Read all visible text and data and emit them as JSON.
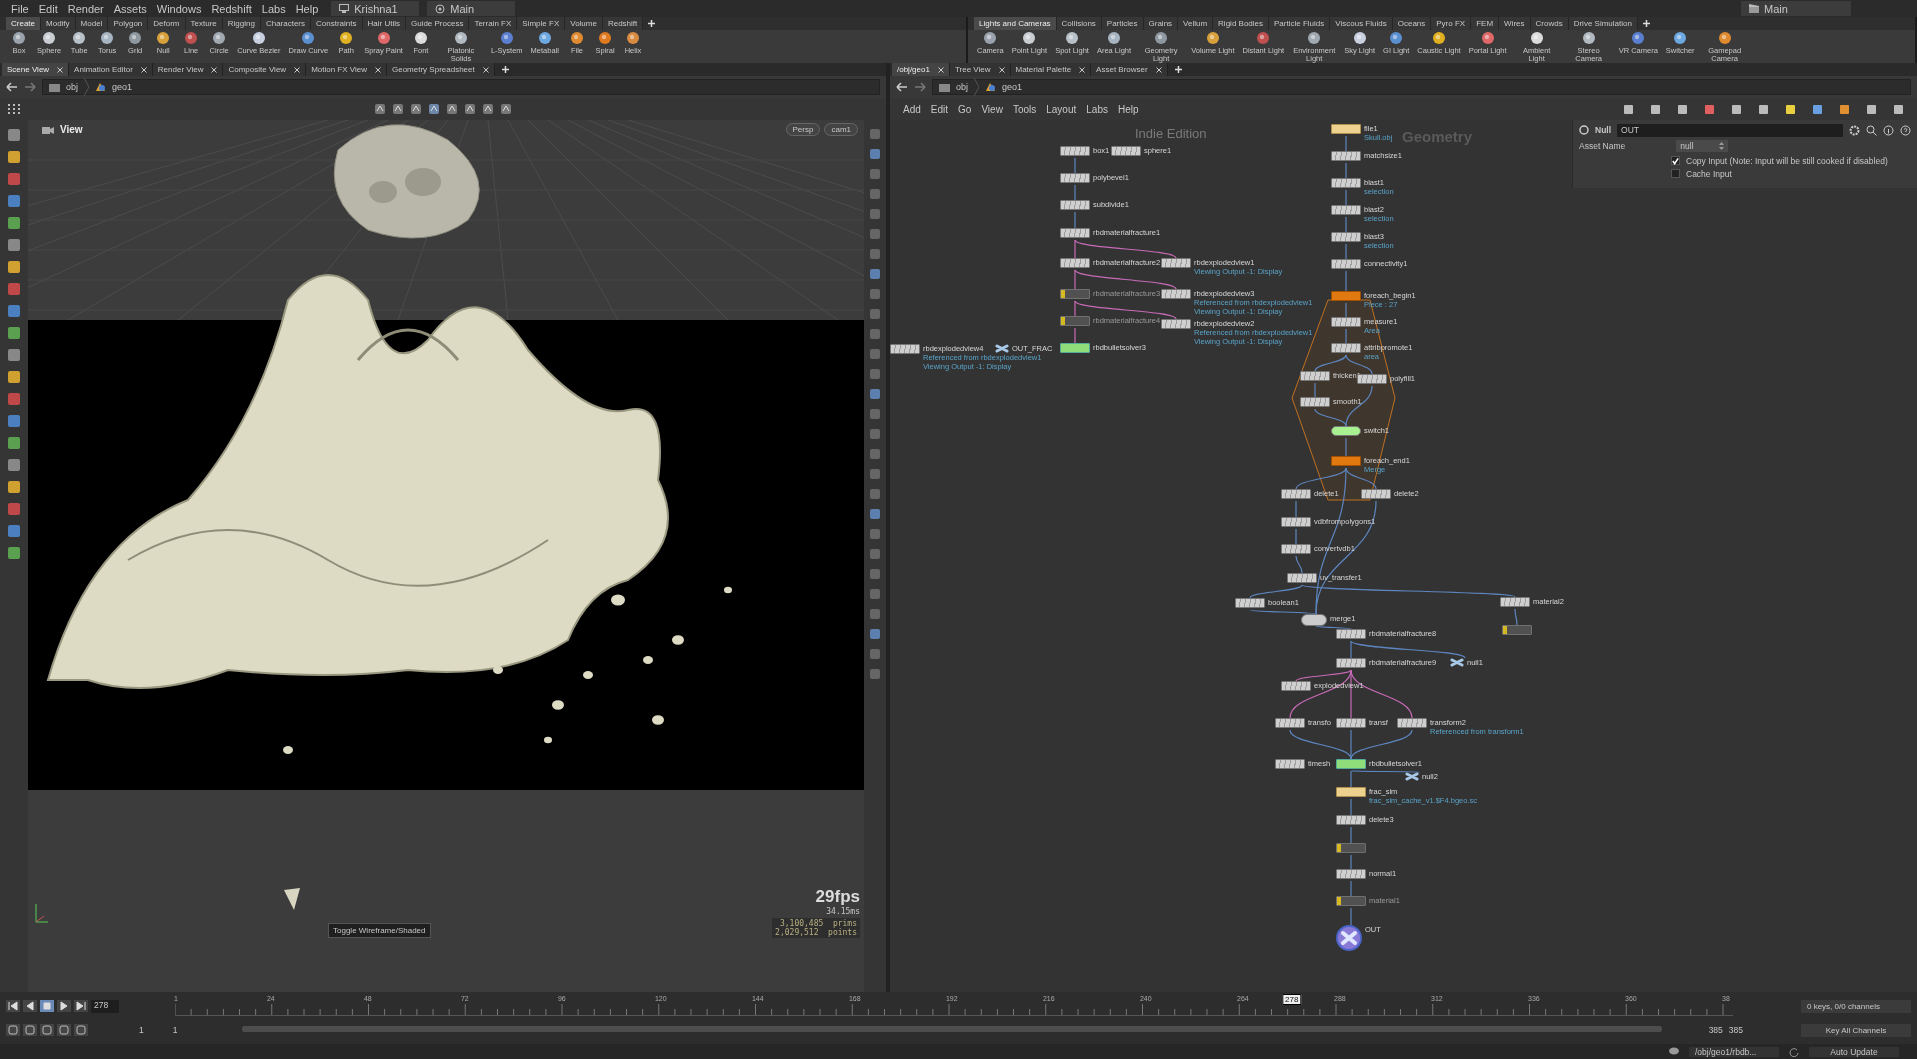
{
  "menubar": {
    "menus": [
      "File",
      "Edit",
      "Render",
      "Assets",
      "Windows",
      "Redshift",
      "Labs",
      "Help"
    ],
    "desktop": "Krishna1",
    "context": "Main",
    "right_context": "Main"
  },
  "shelf_left": {
    "tabs": [
      {
        "label": "Create",
        "selected": true
      },
      {
        "label": "Modify",
        "selected": false
      },
      {
        "label": "Model",
        "selected": false
      },
      {
        "label": "Polygon",
        "selected": false
      },
      {
        "label": "Deform",
        "selected": false
      },
      {
        "label": "Texture",
        "selected": false
      },
      {
        "label": "Rigging",
        "selected": false
      },
      {
        "label": "Characters",
        "selected": false
      },
      {
        "label": "Constraints",
        "selected": false
      },
      {
        "label": "Hair Utils",
        "selected": false
      },
      {
        "label": "Guide Process",
        "selected": false
      },
      {
        "label": "Terrain FX",
        "selected": false
      },
      {
        "label": "Simple FX",
        "selected": false
      },
      {
        "label": "Volume",
        "selected": false
      },
      {
        "label": "Redshift",
        "selected": false
      }
    ],
    "tools": [
      "Box",
      "Sphere",
      "Tube",
      "Torus",
      "Grid",
      "Null",
      "Line",
      "Circle",
      "Curve Bezier",
      "Draw Curve",
      "Path",
      "Spray Paint",
      "Font",
      "Platonic Solids",
      "L-System",
      "Metaball",
      "File",
      "Spiral",
      "Helix"
    ]
  },
  "shelf_right": {
    "tabs": [
      {
        "label": "Lights and Cameras",
        "selected": true
      },
      {
        "label": "Collisions",
        "selected": false
      },
      {
        "label": "Particles",
        "selected": false
      },
      {
        "label": "Grains",
        "selected": false
      },
      {
        "label": "Vellum",
        "selected": false
      },
      {
        "label": "Rigid Bodies",
        "selected": false
      },
      {
        "label": "Particle Fluids",
        "selected": false
      },
      {
        "label": "Viscous Fluids",
        "selected": false
      },
      {
        "label": "Oceans",
        "selected": false
      },
      {
        "label": "Pyro FX",
        "selected": false
      },
      {
        "label": "FEM",
        "selected": false
      },
      {
        "label": "Wires",
        "selected": false
      },
      {
        "label": "Crowds",
        "selected": false
      },
      {
        "label": "Drive Simulation",
        "selected": false
      }
    ],
    "tools": [
      "Camera",
      "Point Light",
      "Spot Light",
      "Area Light",
      "Geometry Light",
      "Volume Light",
      "Distant Light",
      "Environment Light",
      "Sky Light",
      "GI Light",
      "Caustic Light",
      "Portal Light",
      "Ambient Light",
      "Stereo Camera",
      "VR Camera",
      "Switcher",
      "Gamepad Camera"
    ]
  },
  "left_pane": {
    "tabs": [
      {
        "label": "Scene View",
        "selected": true
      },
      {
        "label": "Animation Editor",
        "selected": false
      },
      {
        "label": "Render View",
        "selected": false
      },
      {
        "label": "Composite View",
        "selected": false
      },
      {
        "label": "Motion FX View",
        "selected": false
      },
      {
        "label": "Geometry Spreadsheet",
        "selected": false
      }
    ],
    "path": [
      "obj",
      "geo1"
    ],
    "viewport": {
      "title": "View",
      "projection": "Persp",
      "camera": "cam1",
      "fps": "29fps",
      "frame_time": "34.15ms",
      "prims": "3,100,485  prims",
      "points": "2,029,512  points",
      "tooltip": "Toggle Wireframe/Shaded"
    }
  },
  "right_pane": {
    "tabs": [
      {
        "label": "/obj/geo1",
        "selected": true
      },
      {
        "label": "Tree View",
        "selected": false
      },
      {
        "label": "Material Palette",
        "selected": false
      },
      {
        "label": "Asset Browser",
        "selected": false
      }
    ],
    "path": [
      "obj",
      "geo1"
    ],
    "menus": [
      "Add",
      "Edit",
      "Go",
      "View",
      "Tools",
      "Layout",
      "Labs",
      "Help"
    ],
    "network": {
      "edition": "Indie Edition",
      "context": "Geometry",
      "nodes": [
        {
          "name": "box1",
          "kind": "sop"
        },
        {
          "name": "sphere1",
          "kind": "sop"
        },
        {
          "name": "polybevel1",
          "kind": "sop"
        },
        {
          "name": "subdivide1",
          "kind": "sop"
        },
        {
          "name": "rbdmaterialfracture1",
          "kind": "sop"
        },
        {
          "name": "rbdmaterialfracture2",
          "kind": "sop"
        },
        {
          "name": "rbdmaterialfracture3",
          "kind": "bypass"
        },
        {
          "name": "rbdmaterialfracture4",
          "kind": "bypass"
        },
        {
          "name": "rbdexplodedview4",
          "kind": "sop",
          "notes": [
            "Referenced from rbdexplodedview1",
            "Viewing Output -1: Display"
          ]
        },
        {
          "name": "OUT_FRAC",
          "kind": "null"
        },
        {
          "name": "rbdbulletsolver3",
          "kind": "solver"
        },
        {
          "name": "rbdexplodedview1",
          "kind": "sop",
          "notes": [
            "Viewing Output -1: Display"
          ]
        },
        {
          "name": "rbdexplodedview3",
          "kind": "sop",
          "notes": [
            "Referenced from rbdexplodedview1",
            "Viewing Output -1: Display"
          ]
        },
        {
          "name": "rbdexplodedview2",
          "kind": "sop",
          "notes": [
            "Referenced from rbdexplodedview1",
            "Viewing Output -1: Display"
          ]
        },
        {
          "name": "file1",
          "kind": "file",
          "notes": [
            "Skull.obj"
          ]
        },
        {
          "name": "matchsize1",
          "kind": "sop"
        },
        {
          "name": "blast1",
          "kind": "sop",
          "notes": [
            "selection"
          ]
        },
        {
          "name": "blast2",
          "kind": "sop",
          "notes": [
            "selection"
          ]
        },
        {
          "name": "blast3",
          "kind": "sop",
          "notes": [
            "selection"
          ]
        },
        {
          "name": "connectivity1",
          "kind": "sop"
        },
        {
          "name": "foreach_begin1",
          "kind": "foreach",
          "notes": [
            "Piece : 27"
          ]
        },
        {
          "name": "measure1",
          "kind": "sop",
          "notes": [
            "Area"
          ]
        },
        {
          "name": "attribpromote1",
          "kind": "sop",
          "notes": [
            "area"
          ]
        },
        {
          "name": "thicken1",
          "kind": "sop"
        },
        {
          "name": "polyfill1",
          "kind": "sop"
        },
        {
          "name": "smooth1",
          "kind": "sop"
        },
        {
          "name": "switch1",
          "kind": "switch"
        },
        {
          "name": "foreach_end1",
          "kind": "foreach",
          "notes": [
            "Merge"
          ]
        },
        {
          "name": "delete1",
          "kind": "sop"
        },
        {
          "name": "delete2",
          "kind": "sop"
        },
        {
          "name": "vdbfrompolygons1",
          "kind": "sop"
        },
        {
          "name": "convertvdb1",
          "kind": "sop"
        },
        {
          "name": "uv_transfer1",
          "kind": "sop"
        },
        {
          "name": "boolean1",
          "kind": "sop"
        },
        {
          "name": "merge1",
          "kind": "merge"
        },
        {
          "name": "rbdmaterialfracture8",
          "kind": "sop"
        },
        {
          "name": "rbdmaterialfracture9",
          "kind": "sop"
        },
        {
          "name": "null1",
          "kind": "null"
        },
        {
          "name": "explodedview1",
          "kind": "sop"
        },
        {
          "name": "transfo",
          "kind": "sop"
        },
        {
          "name": "transf",
          "kind": "sop"
        },
        {
          "name": "transform2",
          "kind": "sop",
          "notes": [
            "Referenced from transform1"
          ]
        },
        {
          "name": "timesh",
          "kind": "sop"
        },
        {
          "name": "rbdbulletsolver1",
          "kind": "solver"
        },
        {
          "name": "frac_sim",
          "kind": "filecache",
          "notes": [
            "frac_sim_cache_v1.$F4.bgeo.sc"
          ]
        },
        {
          "name": "null2",
          "kind": "null"
        },
        {
          "name": "delete3",
          "kind": "sop"
        },
        {
          "kind": "bypass"
        },
        {
          "name": "normal1",
          "kind": "sop"
        },
        {
          "name": "material1",
          "kind": "bypass"
        },
        {
          "name": "OUT",
          "kind": "output"
        },
        {
          "name": "material2",
          "kind": "sop"
        },
        {
          "kind": "bypass"
        }
      ]
    },
    "params": {
      "type": "Null",
      "node_name": "OUT",
      "asset_label": "Asset Name",
      "asset_value": "null",
      "toggles": [
        {
          "label": "Copy Input (Note: Input will be still cooked if disabled)",
          "checked": true
        },
        {
          "label": "Cache Input",
          "checked": false
        }
      ]
    }
  },
  "timeline": {
    "frame": "278",
    "ticks": [
      "1",
      "24",
      "48",
      "72",
      "96",
      "120",
      "144",
      "168",
      "192",
      "216",
      "240",
      "264",
      "288",
      "312",
      "336",
      "360",
      "38"
    ],
    "playhead": "278",
    "level": 0.7214,
    "range": {
      "start": "1",
      "start_2": "1",
      "end": "385",
      "end_2": "385",
      "level": 1
    },
    "keys": "0 keys, 0/0 channels",
    "key_button": "Key All Channels"
  },
  "status": {
    "path": "/obj/geo1/rbdb...",
    "update": "Auto Update"
  }
}
